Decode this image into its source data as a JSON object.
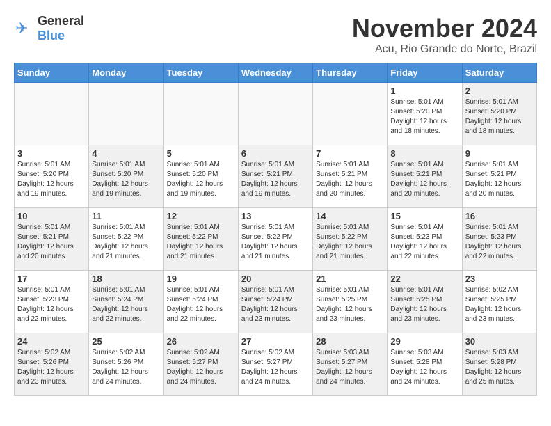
{
  "logo": {
    "general": "General",
    "blue": "Blue"
  },
  "title": "November 2024",
  "subtitle": "Acu, Rio Grande do Norte, Brazil",
  "weekdays": [
    "Sunday",
    "Monday",
    "Tuesday",
    "Wednesday",
    "Thursday",
    "Friday",
    "Saturday"
  ],
  "weeks": [
    [
      {
        "day": "",
        "info": "",
        "empty": true
      },
      {
        "day": "",
        "info": "",
        "empty": true
      },
      {
        "day": "",
        "info": "",
        "empty": true
      },
      {
        "day": "",
        "info": "",
        "empty": true
      },
      {
        "day": "",
        "info": "",
        "empty": true
      },
      {
        "day": "1",
        "info": "Sunrise: 5:01 AM\nSunset: 5:20 PM\nDaylight: 12 hours\nand 18 minutes.",
        "shaded": false
      },
      {
        "day": "2",
        "info": "Sunrise: 5:01 AM\nSunset: 5:20 PM\nDaylight: 12 hours\nand 18 minutes.",
        "shaded": true
      }
    ],
    [
      {
        "day": "3",
        "info": "Sunrise: 5:01 AM\nSunset: 5:20 PM\nDaylight: 12 hours\nand 19 minutes.",
        "shaded": false
      },
      {
        "day": "4",
        "info": "Sunrise: 5:01 AM\nSunset: 5:20 PM\nDaylight: 12 hours\nand 19 minutes.",
        "shaded": true
      },
      {
        "day": "5",
        "info": "Sunrise: 5:01 AM\nSunset: 5:20 PM\nDaylight: 12 hours\nand 19 minutes.",
        "shaded": false
      },
      {
        "day": "6",
        "info": "Sunrise: 5:01 AM\nSunset: 5:21 PM\nDaylight: 12 hours\nand 19 minutes.",
        "shaded": true
      },
      {
        "day": "7",
        "info": "Sunrise: 5:01 AM\nSunset: 5:21 PM\nDaylight: 12 hours\nand 20 minutes.",
        "shaded": false
      },
      {
        "day": "8",
        "info": "Sunrise: 5:01 AM\nSunset: 5:21 PM\nDaylight: 12 hours\nand 20 minutes.",
        "shaded": true
      },
      {
        "day": "9",
        "info": "Sunrise: 5:01 AM\nSunset: 5:21 PM\nDaylight: 12 hours\nand 20 minutes.",
        "shaded": false
      }
    ],
    [
      {
        "day": "10",
        "info": "Sunrise: 5:01 AM\nSunset: 5:21 PM\nDaylight: 12 hours\nand 20 minutes.",
        "shaded": true
      },
      {
        "day": "11",
        "info": "Sunrise: 5:01 AM\nSunset: 5:22 PM\nDaylight: 12 hours\nand 21 minutes.",
        "shaded": false
      },
      {
        "day": "12",
        "info": "Sunrise: 5:01 AM\nSunset: 5:22 PM\nDaylight: 12 hours\nand 21 minutes.",
        "shaded": true
      },
      {
        "day": "13",
        "info": "Sunrise: 5:01 AM\nSunset: 5:22 PM\nDaylight: 12 hours\nand 21 minutes.",
        "shaded": false
      },
      {
        "day": "14",
        "info": "Sunrise: 5:01 AM\nSunset: 5:22 PM\nDaylight: 12 hours\nand 21 minutes.",
        "shaded": true
      },
      {
        "day": "15",
        "info": "Sunrise: 5:01 AM\nSunset: 5:23 PM\nDaylight: 12 hours\nand 22 minutes.",
        "shaded": false
      },
      {
        "day": "16",
        "info": "Sunrise: 5:01 AM\nSunset: 5:23 PM\nDaylight: 12 hours\nand 22 minutes.",
        "shaded": true
      }
    ],
    [
      {
        "day": "17",
        "info": "Sunrise: 5:01 AM\nSunset: 5:23 PM\nDaylight: 12 hours\nand 22 minutes.",
        "shaded": false
      },
      {
        "day": "18",
        "info": "Sunrise: 5:01 AM\nSunset: 5:24 PM\nDaylight: 12 hours\nand 22 minutes.",
        "shaded": true
      },
      {
        "day": "19",
        "info": "Sunrise: 5:01 AM\nSunset: 5:24 PM\nDaylight: 12 hours\nand 22 minutes.",
        "shaded": false
      },
      {
        "day": "20",
        "info": "Sunrise: 5:01 AM\nSunset: 5:24 PM\nDaylight: 12 hours\nand 23 minutes.",
        "shaded": true
      },
      {
        "day": "21",
        "info": "Sunrise: 5:01 AM\nSunset: 5:25 PM\nDaylight: 12 hours\nand 23 minutes.",
        "shaded": false
      },
      {
        "day": "22",
        "info": "Sunrise: 5:01 AM\nSunset: 5:25 PM\nDaylight: 12 hours\nand 23 minutes.",
        "shaded": true
      },
      {
        "day": "23",
        "info": "Sunrise: 5:02 AM\nSunset: 5:25 PM\nDaylight: 12 hours\nand 23 minutes.",
        "shaded": false
      }
    ],
    [
      {
        "day": "24",
        "info": "Sunrise: 5:02 AM\nSunset: 5:26 PM\nDaylight: 12 hours\nand 23 minutes.",
        "shaded": true
      },
      {
        "day": "25",
        "info": "Sunrise: 5:02 AM\nSunset: 5:26 PM\nDaylight: 12 hours\nand 24 minutes.",
        "shaded": false
      },
      {
        "day": "26",
        "info": "Sunrise: 5:02 AM\nSunset: 5:27 PM\nDaylight: 12 hours\nand 24 minutes.",
        "shaded": true
      },
      {
        "day": "27",
        "info": "Sunrise: 5:02 AM\nSunset: 5:27 PM\nDaylight: 12 hours\nand 24 minutes.",
        "shaded": false
      },
      {
        "day": "28",
        "info": "Sunrise: 5:03 AM\nSunset: 5:27 PM\nDaylight: 12 hours\nand 24 minutes.",
        "shaded": true
      },
      {
        "day": "29",
        "info": "Sunrise: 5:03 AM\nSunset: 5:28 PM\nDaylight: 12 hours\nand 24 minutes.",
        "shaded": false
      },
      {
        "day": "30",
        "info": "Sunrise: 5:03 AM\nSunset: 5:28 PM\nDaylight: 12 hours\nand 25 minutes.",
        "shaded": true
      }
    ]
  ]
}
